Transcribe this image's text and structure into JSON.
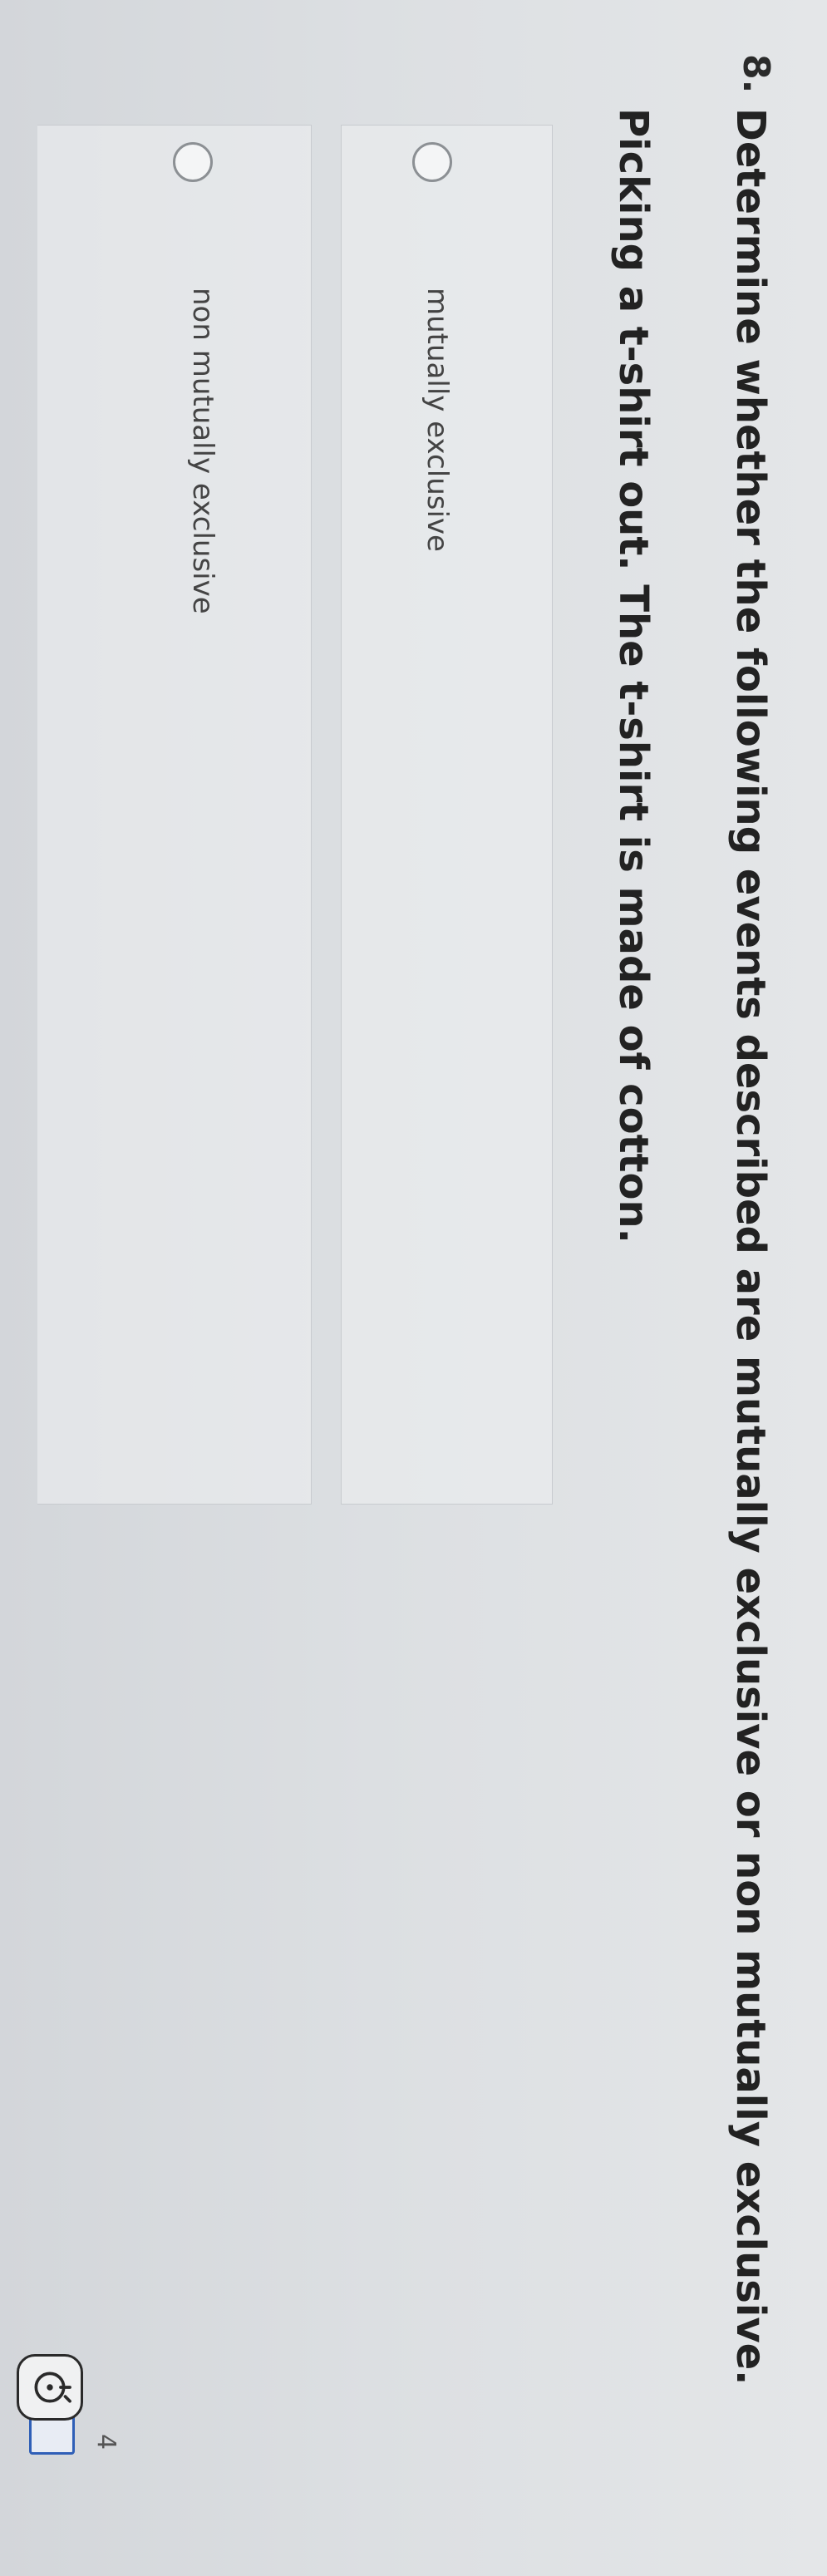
{
  "question": {
    "number": "8.",
    "text": "Determine whether the following events described are mutually exclusive or non mutually exclusive.",
    "sub_text": "Picking a t-shirt out. The t-shirt is made of cotton."
  },
  "choices": [
    {
      "label": "mutually exclusive",
      "selected": false
    },
    {
      "label": "non mutually exclusive",
      "selected": false
    }
  ],
  "page_number": "4",
  "icons": {
    "flag": "bookmark-flag-icon",
    "tool": "calculator-icon"
  },
  "colors": {
    "accent": "#2f5fb7",
    "text": "#222222"
  }
}
